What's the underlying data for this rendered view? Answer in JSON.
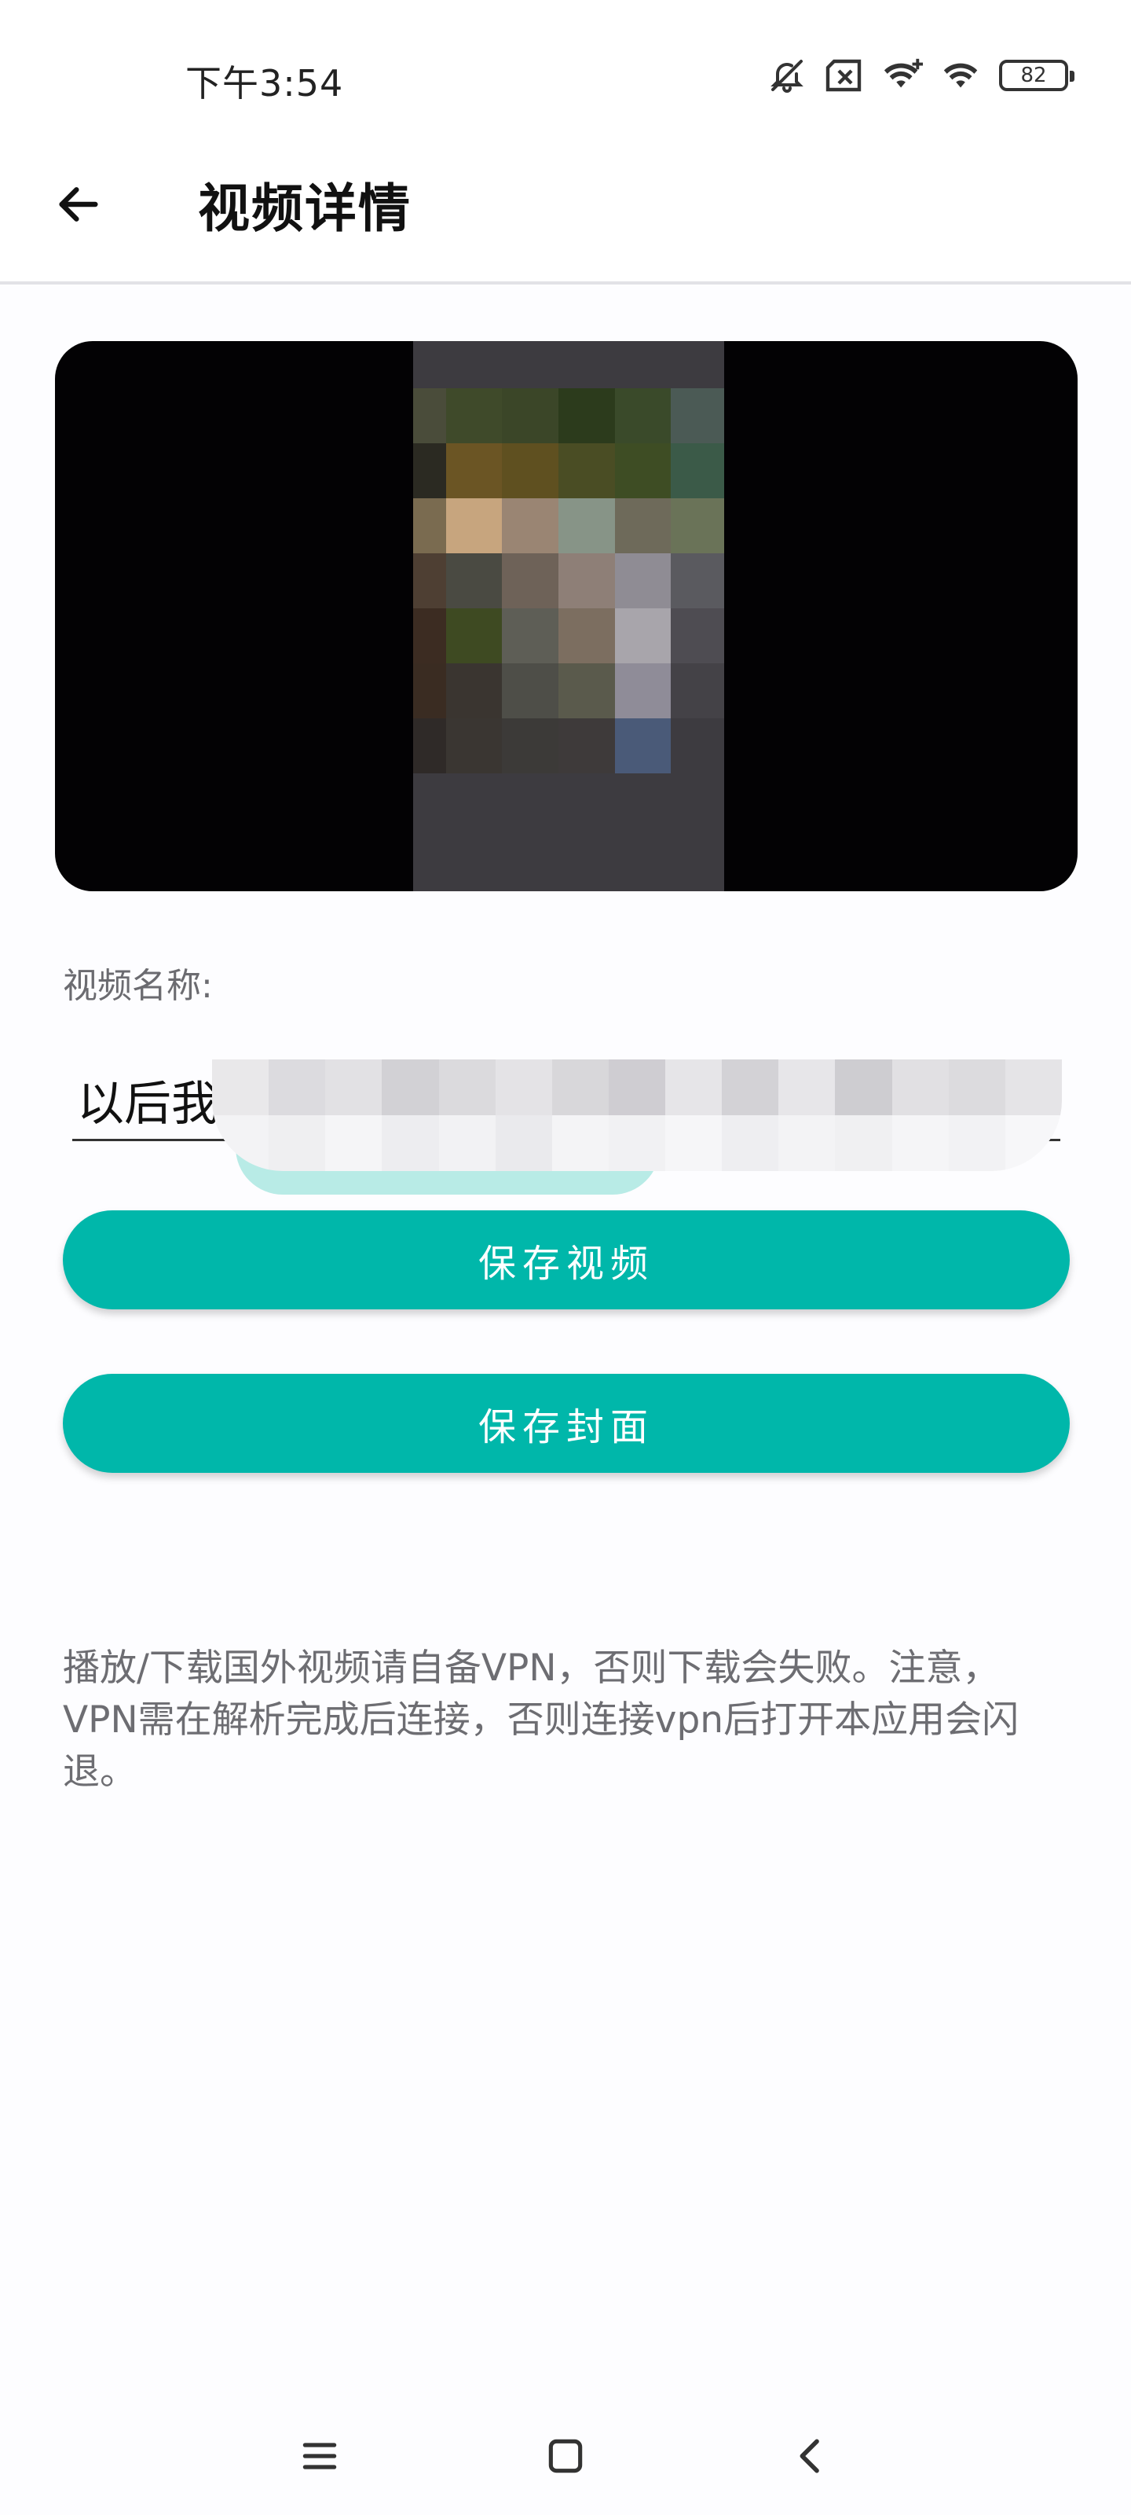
{
  "status_bar": {
    "time": "下午3:54",
    "battery": "82",
    "icons": [
      "bell-off-icon",
      "sim-error-icon",
      "wifi-plus-icon",
      "wifi-icon",
      "battery-icon"
    ]
  },
  "header": {
    "title": "视频详情",
    "back_icon": "arrow-left-icon"
  },
  "form": {
    "name_label": "视频名称:",
    "name_value": "以后我"
  },
  "buttons": {
    "save_video": "保存视频",
    "save_cover": "保存封面"
  },
  "notice": "播放/下载国外视频请自备VPN，否则下载会失败。注意，VPN需在解析完成后连接，否则连接vpn后打开本应用会闪退。",
  "nav_bar": {
    "icons": [
      "menu-icon",
      "home-square-icon",
      "back-chevron-icon"
    ]
  },
  "colors": {
    "accent": "#00b7aa",
    "notice_text": "#6d6d72",
    "video_bg": "#030204"
  }
}
